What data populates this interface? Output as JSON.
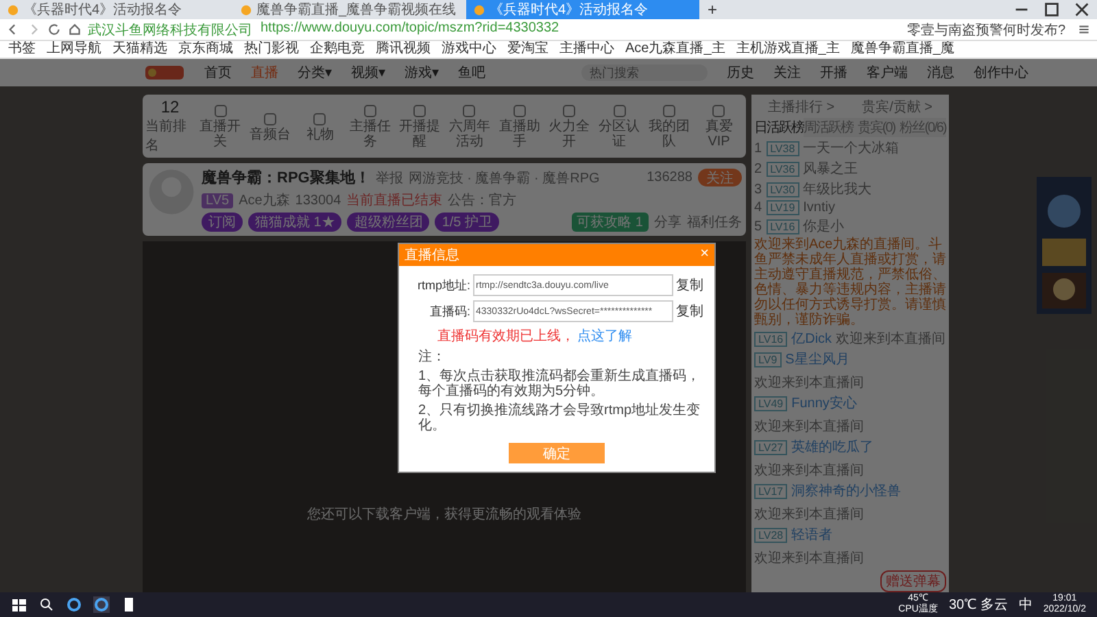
{
  "browser": {
    "tabs": [
      {
        "title": "《兵器时代4》活动报名令",
        "selected": false
      },
      {
        "title": "魔兽争霸直播_魔兽争霸视频在线",
        "selected": false
      },
      {
        "title": "《兵器时代4》活动报名令",
        "selected": true
      }
    ],
    "new_tab": "+",
    "site_owner": "武汉斗鱼网络科技有限公司",
    "url": "https://www.douyu.com/topic/mszm?rid=4330332",
    "search_hint": "零壹与南盗预警何时发布?",
    "bookmarks": [
      "书签",
      "上网导航",
      "天猫精选",
      "京东商城",
      "热门影视",
      "企鹅电竞",
      "腾讯视频",
      "游戏中心",
      "爱淘宝",
      "主播中心",
      "Ace九森直播_主",
      "主机游戏直播_主",
      "魔兽争霸直播_魔"
    ]
  },
  "site_nav": {
    "items": [
      {
        "label": "首页",
        "selected": false
      },
      {
        "label": "直播",
        "selected": true
      },
      {
        "label": "分类▾",
        "selected": false
      },
      {
        "label": "视频▾",
        "selected": false
      },
      {
        "label": "游戏▾",
        "selected": false
      },
      {
        "label": "鱼吧",
        "selected": false
      }
    ],
    "search": {
      "placeholder": "热门搜索"
    },
    "actions": [
      "历史",
      "关注",
      "开播",
      "客户端",
      "消息",
      "创作中心"
    ]
  },
  "toolbar": {
    "rank": "12",
    "rank_label": "当前排名",
    "items": [
      "直播开关",
      "音频台",
      "礼物",
      "主播任务",
      "开播提醒",
      "六周年活动",
      "直播助手",
      "火力全开",
      "分区认证",
      "我的团队",
      "真爱VIP"
    ]
  },
  "room": {
    "title": "魔兽争霸：RPG聚集地！",
    "report": "举报",
    "category": "网游竞技 · 魔兽争霸 · 魔兽RPG",
    "level": "LV5",
    "anchor": "Ace九森",
    "hot": "133004",
    "notice": "当前直播已结束",
    "announce": "公告：官方",
    "followers": "136288",
    "follow": "关注",
    "badges": [
      "订阅",
      "猫猫成就 1★",
      "超级粉丝团",
      "1/5 护卫"
    ],
    "reward": "可获攻略",
    "reward_count": "1",
    "share": "分享",
    "task": "福利任务",
    "video_hint": "您还可以下载客户端，获得更流畅的观看体验"
  },
  "chat": {
    "headers": [
      "主播排行 >",
      "贵宾/贡献 >"
    ],
    "tabs": [
      {
        "label": "日活跃榜",
        "selected": true
      },
      {
        "label": "周活跃榜",
        "selected": false
      },
      {
        "label": "贵宾(0)",
        "selected": false
      },
      {
        "label": "粉丝(0/6)",
        "selected": false
      }
    ],
    "ranks": [
      {
        "no": "1",
        "level": "LV38",
        "name": "一天一个大冰箱"
      },
      {
        "no": "2",
        "level": "LV36",
        "name": "风暴之王"
      },
      {
        "no": "3",
        "level": "LV30",
        "name": "年级比我大"
      },
      {
        "no": "4",
        "level": "LV19",
        "name": "Ivntiy"
      },
      {
        "no": "5",
        "level": "LV16",
        "name": "你是小"
      }
    ],
    "system": "欢迎来到Ace九森的直播间。斗鱼严禁未成年人直播或打赏，请主动遵守直播规范，严禁低俗、色情、暴力等违规内容，主播请勿以任何方式诱导打赏。请谨慎甄别，谨防诈骗。",
    "messages": [
      {
        "level": "LV16",
        "name": "亿Dick",
        "text": "欢迎来到本直播间"
      },
      {
        "level": "LV9",
        "name": "S星尘风月",
        "text": "欢迎来到本直播间"
      },
      {
        "level": "LV49",
        "name": "Funny安心",
        "text": "欢迎来到本直播间"
      },
      {
        "level": "LV27",
        "name": "英雄的吃瓜了",
        "text": "欢迎来到本直播间"
      },
      {
        "level": "LV17",
        "name": "洞察神奇的小怪兽",
        "text": "欢迎来到本直播间"
      },
      {
        "level": "LV28",
        "name": "轻语者",
        "text": "欢迎来到本直播间"
      }
    ],
    "gift": "赠送弹幕"
  },
  "dialog": {
    "title": "直播信息",
    "close": "×",
    "fields": [
      {
        "label": "rtmp地址:",
        "value": "rtmp://sendtc3a.douyu.com/live",
        "copy": "复制"
      },
      {
        "label": "直播码:",
        "value": "4330332rUo4dcL?wsSecret=**************",
        "copy": "复制"
      }
    ],
    "warning": "直播码有效期已上线，",
    "link": "点这了解",
    "notes": [
      "注：",
      "1、每次点击获取推流码都会重新生成直播码，每个直播码的有效期为5分钟。",
      "2、只有切换推流线路才会导致rtmp地址发生变化。"
    ],
    "confirm": "确定"
  },
  "taskbar": {
    "cpu_temp": "45℃",
    "cpu_label": "CPU温度",
    "weather": "30℃ 多云",
    "ime": "中",
    "time": "19:01",
    "date": "2022/10/2"
  }
}
